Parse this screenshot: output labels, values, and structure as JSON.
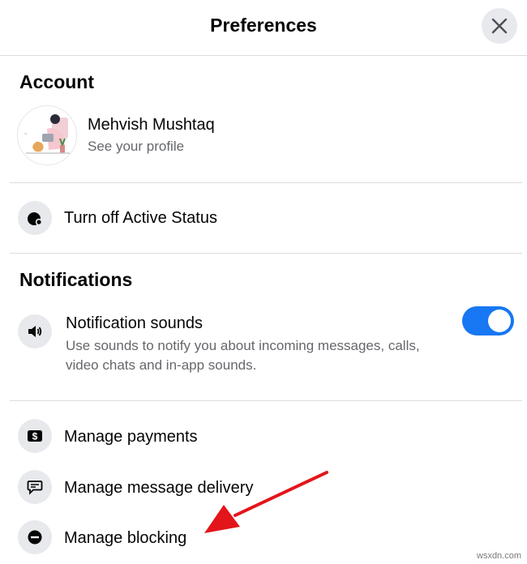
{
  "header": {
    "title": "Preferences",
    "close_icon": "close-icon"
  },
  "account": {
    "section_title": "Account",
    "profile_name": "Mehvish Mushtaq",
    "profile_subtitle": "See your profile"
  },
  "active_status": {
    "label": "Turn off Active Status",
    "icon": "active-status-icon"
  },
  "notifications": {
    "section_title": "Notifications",
    "sounds_label": "Notification sounds",
    "sounds_description": "Use sounds to notify you about incoming messages, calls, video chats and in-app sounds.",
    "sounds_enabled": true,
    "icon": "speaker-icon"
  },
  "menu": {
    "payments": "Manage payments",
    "message_delivery": "Manage message delivery",
    "blocking": "Manage blocking"
  },
  "colors": {
    "accent": "#1877f2",
    "arrow": "#e3151a",
    "icon_bg": "#e8e9ed"
  },
  "watermark": "wsxdn.com"
}
